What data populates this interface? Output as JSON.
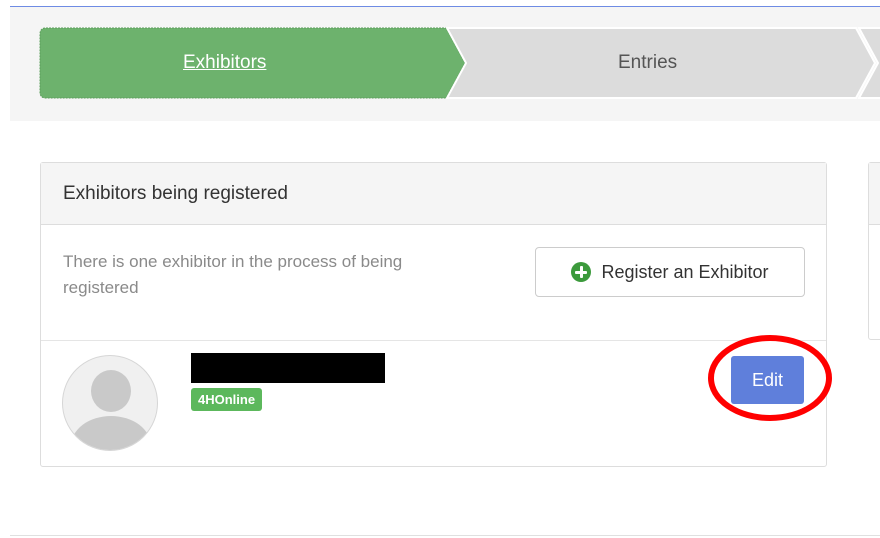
{
  "steps": [
    {
      "label": "Exhibitors",
      "active": true
    },
    {
      "label": "Entries",
      "active": false
    }
  ],
  "colors": {
    "step_active": "#6db26d",
    "step_inactive": "#dcdcdc",
    "edit_button": "#5f7fdb",
    "badge": "#5cb85c",
    "highlight_ring": "#ff0000"
  },
  "panel": {
    "title": "Exhibitors being registered",
    "info_text": "There is one exhibitor in the process of being registered",
    "register_button_label": "Register an Exhibitor",
    "register_button_icon": "plus-circle-icon"
  },
  "exhibitor": {
    "avatar_icon": "user-avatar-icon",
    "badge": "4HOnline",
    "edit_label": "Edit"
  }
}
